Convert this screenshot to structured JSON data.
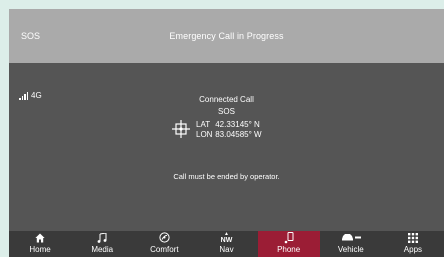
{
  "titlebar": {
    "left_label": "SOS",
    "title": "Emergency Call in Progress"
  },
  "status": {
    "network": "4G"
  },
  "call": {
    "status": "Connected Call",
    "name": "SOS",
    "lat_label": "LAT",
    "lat_value": "42.33145° N",
    "lon_label": "LON",
    "lon_value": "83.04585° W",
    "message": "Call must be ended by operator."
  },
  "nav": {
    "compass": "NW",
    "items": [
      {
        "label": "Home",
        "icon": "home-icon"
      },
      {
        "label": "Media",
        "icon": "music-note-icon"
      },
      {
        "label": "Comfort",
        "icon": "climate-icon"
      },
      {
        "label": "Nav",
        "icon": "compass-icon"
      },
      {
        "label": "Phone",
        "icon": "phone-icon",
        "active": true
      },
      {
        "label": "Vehicle",
        "icon": "car-icon"
      },
      {
        "label": "Apps",
        "icon": "apps-grid-icon"
      }
    ]
  },
  "colors": {
    "active_tab": "#9b1d35",
    "titlebar": "#aaaaaa",
    "background": "#555555"
  }
}
